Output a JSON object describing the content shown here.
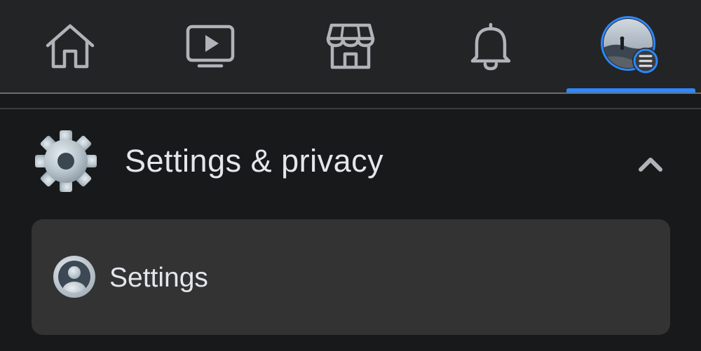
{
  "nav": {
    "items": [
      {
        "name": "home",
        "icon": "home-icon"
      },
      {
        "name": "watch",
        "icon": "video-play-icon"
      },
      {
        "name": "marketplace",
        "icon": "storefront-icon"
      },
      {
        "name": "notifications",
        "icon": "bell-icon"
      },
      {
        "name": "menu",
        "icon": "profile-avatar-menu-icon",
        "active": true
      }
    ],
    "accent_color": "#2d88ff"
  },
  "section": {
    "title": "Settings & privacy",
    "icon": "gear-icon",
    "expanded": true
  },
  "items": [
    {
      "label": "Settings",
      "icon": "user-circle-icon"
    }
  ]
}
